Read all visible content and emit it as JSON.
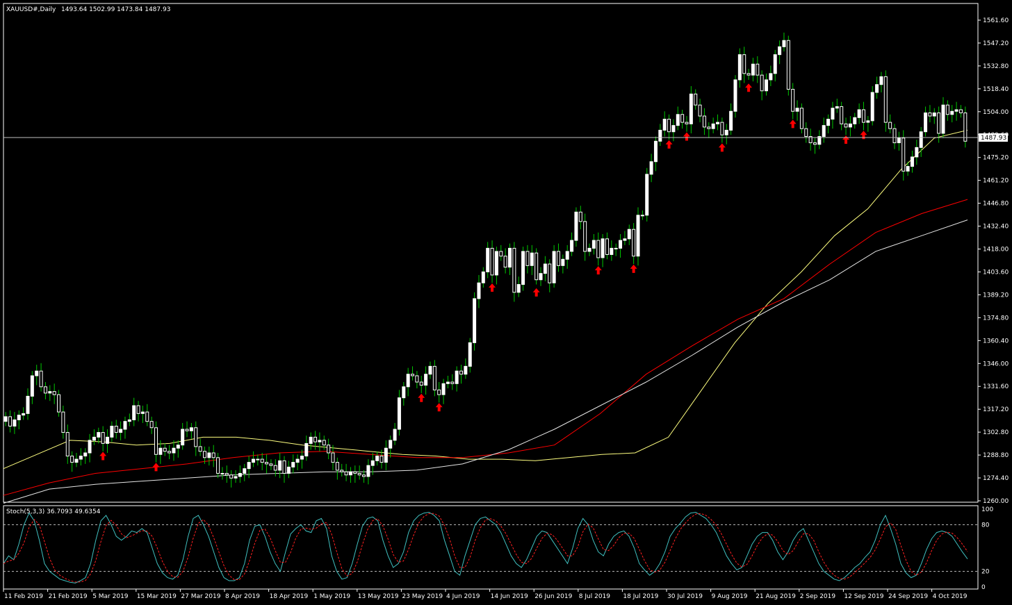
{
  "header": {
    "symbol": "XAUUSD#,Daily",
    "ohlc": "1493.64 1502.99 1473.84 1487.93"
  },
  "price_axis": {
    "labels": [
      "1561.60",
      "1547.20",
      "1532.80",
      "1518.40",
      "1504.00",
      "1489.60",
      "1475.20",
      "1461.20",
      "1446.80",
      "1432.40",
      "1418.00",
      "1403.60",
      "1389.20",
      "1374.80",
      "1360.40",
      "1346.00",
      "1331.60",
      "1317.20",
      "1302.80",
      "1288.80",
      "1274.40",
      "1260.00"
    ],
    "current_price_label": "1487.93"
  },
  "stoch_panel": {
    "label": "Stoch(5,3,3) 36.7093 49.6354",
    "levels": [
      "100",
      "80",
      "20",
      "0"
    ]
  },
  "date_axis": {
    "labels": [
      "11 Feb 2019",
      "21 Feb 2019",
      "5 Mar 2019",
      "15 Mar 2019",
      "27 Mar 2019",
      "8 Apr 2019",
      "18 Apr 2019",
      "1 May 2019",
      "13 May 2019",
      "23 May 2019",
      "4 Jun 2019",
      "14 Jun 2019",
      "26 Jun 2019",
      "8 Jul 2019",
      "18 Jul 2019",
      "30 Jul 2019",
      "9 Aug 2019",
      "21 Aug 2019",
      "2 Sep 2019",
      "12 Sep 2019",
      "24 Sep 2019",
      "4 Oct 2019"
    ]
  },
  "colors": {
    "background": "#000000",
    "bull_candle": "#ffffff",
    "bear_candle": "#ffffff",
    "wick": "#00c800",
    "ma_fast": "#ffff80",
    "ma_mid": "#ff0000",
    "ma_slow": "#e6e6e6",
    "stoch_main": "#40c0c0",
    "stoch_signal": "#ff2020",
    "buy_arrow": "#ff0000",
    "sell_arrow": "#008000",
    "grid_dash": "#c0c0c0"
  },
  "chart_data": {
    "type": "candlestick",
    "symbol": "XAUUSD#",
    "timeframe": "Daily",
    "ylim": [
      1260.0,
      1568.0
    ],
    "x_ticks": [
      "11 Feb 2019",
      "21 Feb 2019",
      "5 Mar 2019",
      "15 Mar 2019",
      "27 Mar 2019",
      "8 Apr 2019",
      "18 Apr 2019",
      "1 May 2019",
      "13 May 2019",
      "23 May 2019",
      "4 Jun 2019",
      "14 Jun 2019",
      "26 Jun 2019",
      "8 Jul 2019",
      "18 Jul 2019",
      "30 Jul 2019",
      "9 Aug 2019",
      "21 Aug 2019",
      "2 Sep 2019",
      "12 Sep 2019",
      "24 Sep 2019",
      "4 Oct 2019"
    ],
    "close": [
      1313,
      1307,
      1311,
      1314,
      1315,
      1326,
      1339,
      1342,
      1332,
      1328,
      1329,
      1327,
      1316,
      1303,
      1288,
      1284,
      1286,
      1288,
      1290,
      1298,
      1300,
      1303,
      1296,
      1300,
      1307,
      1303,
      1305,
      1310,
      1311,
      1320,
      1315,
      1316,
      1310,
      1306,
      1289,
      1293,
      1291,
      1290,
      1293,
      1295,
      1305,
      1304,
      1306,
      1294,
      1291,
      1287,
      1290,
      1287,
      1277,
      1277,
      1276,
      1274,
      1275,
      1277,
      1280,
      1284,
      1286,
      1286,
      1284,
      1283,
      1282,
      1279,
      1285,
      1277,
      1281,
      1284,
      1286,
      1288,
      1296,
      1300,
      1297,
      1298,
      1295,
      1290,
      1284,
      1279,
      1278,
      1276,
      1278,
      1277,
      1276,
      1275,
      1282,
      1285,
      1288,
      1284,
      1293,
      1298,
      1305,
      1325,
      1332,
      1340,
      1339,
      1335,
      1333,
      1340,
      1345,
      1330,
      1327,
      1334,
      1335,
      1334,
      1342,
      1340,
      1345,
      1360,
      1388,
      1398,
      1405,
      1420,
      1403,
      1418,
      1415,
      1408,
      1420,
      1392,
      1397,
      1418,
      1409,
      1417,
      1400,
      1404,
      1410,
      1398,
      1418,
      1409,
      1413,
      1418,
      1425,
      1443,
      1437,
      1418,
      1420,
      1425,
      1414,
      1426,
      1416,
      1420,
      1420,
      1425,
      1426,
      1432,
      1415,
      1441,
      1441,
      1467,
      1475,
      1488,
      1495,
      1502,
      1494,
      1498,
      1505,
      1500,
      1499,
      1518,
      1511,
      1504,
      1497,
      1496,
      1499,
      1500,
      1492,
      1495,
      1507,
      1527,
      1543,
      1531,
      1530,
      1537,
      1530,
      1520,
      1527,
      1531,
      1543,
      1548,
      1552,
      1521,
      1507,
      1509,
      1496,
      1491,
      1487,
      1486,
      1491,
      1498,
      1502,
      1509,
      1510,
      1499,
      1497,
      1499,
      1503,
      1508,
      1500,
      1501,
      1519,
      1524,
      1529,
      1500,
      1496,
      1487,
      1490,
      1469,
      1472,
      1478,
      1484,
      1494,
      1506,
      1504,
      1506,
      1493,
      1511,
      1505,
      1507,
      1508,
      1506,
      1488
    ],
    "ma_fast": [
      1280,
      1289,
      1298,
      1297,
      1295,
      1296,
      1300,
      1300,
      1298,
      1295,
      1293,
      1291,
      1289,
      1288,
      1286,
      1286,
      1285,
      1287,
      1289,
      1290,
      1300,
      1330,
      1360,
      1385,
      1405,
      1428,
      1445,
      1470,
      1490,
      1495
    ],
    "ma_mid": [
      1263,
      1271,
      1277,
      1280,
      1283,
      1287,
      1290,
      1291,
      1289,
      1287,
      1287,
      1290,
      1295,
      1315,
      1340,
      1358,
      1375,
      1388,
      1410,
      1430,
      1442,
      1451
    ],
    "ma_slow": [
      1258,
      1267,
      1270,
      1272,
      1274,
      1276,
      1277,
      1278,
      1278,
      1279,
      1283,
      1292,
      1305,
      1320,
      1335,
      1352,
      1370,
      1386,
      1400,
      1418,
      1428,
      1438
    ],
    "stoch_main": [
      30,
      40,
      35,
      55,
      80,
      95,
      85,
      60,
      30,
      20,
      15,
      10,
      8,
      6,
      5,
      8,
      12,
      30,
      60,
      85,
      92,
      80,
      65,
      60,
      65,
      72,
      70,
      75,
      70,
      50,
      30,
      18,
      12,
      10,
      15,
      35,
      65,
      88,
      92,
      80,
      65,
      45,
      25,
      12,
      8,
      8,
      12,
      30,
      60,
      78,
      80,
      65,
      45,
      30,
      20,
      45,
      68,
      75,
      80,
      72,
      70,
      85,
      88,
      75,
      40,
      20,
      10,
      12,
      30,
      55,
      78,
      88,
      90,
      85,
      60,
      40,
      25,
      30,
      45,
      70,
      85,
      92,
      95,
      96,
      92,
      85,
      60,
      40,
      20,
      15,
      40,
      60,
      80,
      88,
      90,
      85,
      80,
      70,
      55,
      40,
      30,
      25,
      35,
      50,
      65,
      72,
      70,
      60,
      50,
      40,
      30,
      50,
      75,
      88,
      80,
      60,
      45,
      40,
      55,
      65,
      70,
      72,
      65,
      50,
      30,
      22,
      15,
      20,
      30,
      45,
      65,
      75,
      82,
      90,
      95,
      96,
      92,
      88,
      80,
      70,
      55,
      40,
      30,
      22,
      25,
      40,
      55,
      65,
      70,
      70,
      60,
      45,
      35,
      45,
      60,
      70,
      75,
      60,
      45,
      30,
      20,
      15,
      10,
      8,
      12,
      18,
      25,
      30,
      38,
      45,
      60,
      80,
      92,
      75,
      55,
      30,
      18,
      12,
      15,
      30,
      48,
      62,
      70,
      72,
      70,
      65,
      55,
      45,
      36
    ]
  }
}
